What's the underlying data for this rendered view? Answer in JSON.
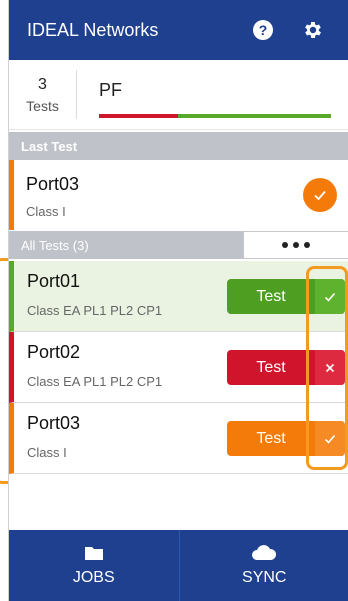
{
  "header": {
    "title": "IDEAL Networks",
    "help_icon": "help-icon",
    "settings_icon": "gear-icon"
  },
  "summary": {
    "count": "3",
    "count_label": "Tests",
    "status": "PF"
  },
  "last_test": {
    "section_label": "Last Test",
    "port": "Port03",
    "class": "Class I",
    "status_icon": "check-circle-icon"
  },
  "all_tests": {
    "section_label": "All Tests (3)",
    "more_icon": "more-dots-icon",
    "rows": [
      {
        "port": "Port01",
        "class": "Class EA PL1 PL2 CP1",
        "button_label": "Test",
        "status": "pass",
        "status_glyph": "✓"
      },
      {
        "port": "Port02",
        "class": "Class EA PL1 PL2 CP1",
        "button_label": "Test",
        "status": "fail",
        "status_glyph": "✕"
      },
      {
        "port": "Port03",
        "class": "Class I",
        "button_label": "Test",
        "status": "warn",
        "status_glyph": "✓"
      }
    ]
  },
  "footer": {
    "jobs_label": "JOBS",
    "sync_label": "SYNC",
    "jobs_icon": "folder-icon",
    "sync_icon": "cloud-icon"
  },
  "colors": {
    "header_bg": "#1f3f8f",
    "pass": "#5aa82a",
    "fail": "#d0142c",
    "warn": "#f47b0a",
    "highlight": "#f39b1f"
  }
}
